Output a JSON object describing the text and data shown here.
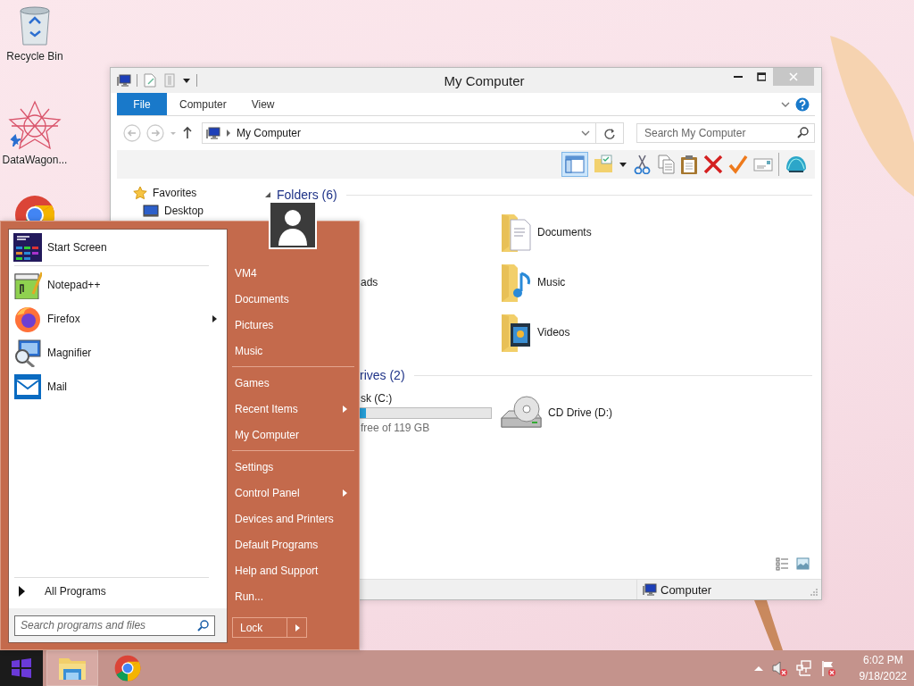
{
  "desktop_icons": [
    {
      "label": "Recycle Bin",
      "kind": "bin"
    },
    {
      "label": "DataWagon...",
      "kind": "star"
    },
    {
      "kind": "chrome"
    }
  ],
  "explorer": {
    "title": "My Computer",
    "ribbon_tabs": [
      {
        "label": "File",
        "selected": true
      },
      {
        "label": "Computer",
        "selected": false
      },
      {
        "label": "View",
        "selected": false
      }
    ],
    "address": "My Computer",
    "search": {
      "placeholder": "Search My Computer"
    },
    "pane_toggle": {
      "on": true
    },
    "nav_pane": [
      {
        "label": "Favorites",
        "children": [
          {
            "label": "Desktop"
          }
        ]
      }
    ],
    "groups": [
      {
        "header": "Folders (6)",
        "expanded": true,
        "items": [
          {
            "kind": "hidden"
          },
          {
            "label": "Documents",
            "kind": "documents"
          },
          {
            "label": "ads",
            "kind": "hidden"
          },
          {
            "label": "Music",
            "kind": "music"
          },
          {
            "kind": "hidden"
          },
          {
            "label": "Videos",
            "kind": "videos"
          }
        ]
      },
      {
        "header": "rives (2)",
        "items": [
          {
            "label": "sk (C:)",
            "kind": "disk",
            "level": 0.25,
            "detail": "free of 119 GB"
          },
          {
            "label": "CD Drive (D:)",
            "kind": "cd"
          }
        ]
      }
    ],
    "status_bar": {
      "location": "Computer"
    }
  },
  "start_menu": {
    "pinned": [
      {
        "label": "Start Screen",
        "kind": "start"
      }
    ],
    "recent": [
      {
        "label": "Notepad++",
        "kind": "notepad",
        "submenu": false
      },
      {
        "label": "Firefox",
        "kind": "firefox",
        "submenu": true
      },
      {
        "label": "Magnifier",
        "kind": "magnifier",
        "submenu": false
      },
      {
        "label": "Mail",
        "kind": "mail",
        "submenu": false
      }
    ],
    "all_programs": "All Programs",
    "search": {
      "placeholder": "Search programs and files"
    },
    "right_groups": [
      [
        {
          "label": "VM4",
          "submenu": false
        },
        {
          "label": "Documents",
          "submenu": false
        },
        {
          "label": "Pictures",
          "submenu": false
        },
        {
          "label": "Music",
          "submenu": false
        }
      ],
      [
        {
          "label": "Games",
          "submenu": false
        },
        {
          "label": "Recent Items",
          "submenu": true
        },
        {
          "label": "My Computer",
          "submenu": false
        }
      ],
      [
        {
          "label": "Settings",
          "submenu": false
        },
        {
          "label": "Control Panel",
          "submenu": true
        },
        {
          "label": "Devices and Printers",
          "submenu": false
        },
        {
          "label": "Default Programs",
          "submenu": false
        },
        {
          "label": "Help and Support",
          "submenu": false
        },
        {
          "label": "Run...",
          "submenu": false
        }
      ]
    ],
    "power_button": "Lock"
  },
  "taskbar": {
    "apps": [
      {
        "kind": "explorer",
        "selected": true
      },
      {
        "kind": "chrome",
        "selected": false
      }
    ],
    "time": "6:02 PM",
    "date": "9/18/2022"
  }
}
